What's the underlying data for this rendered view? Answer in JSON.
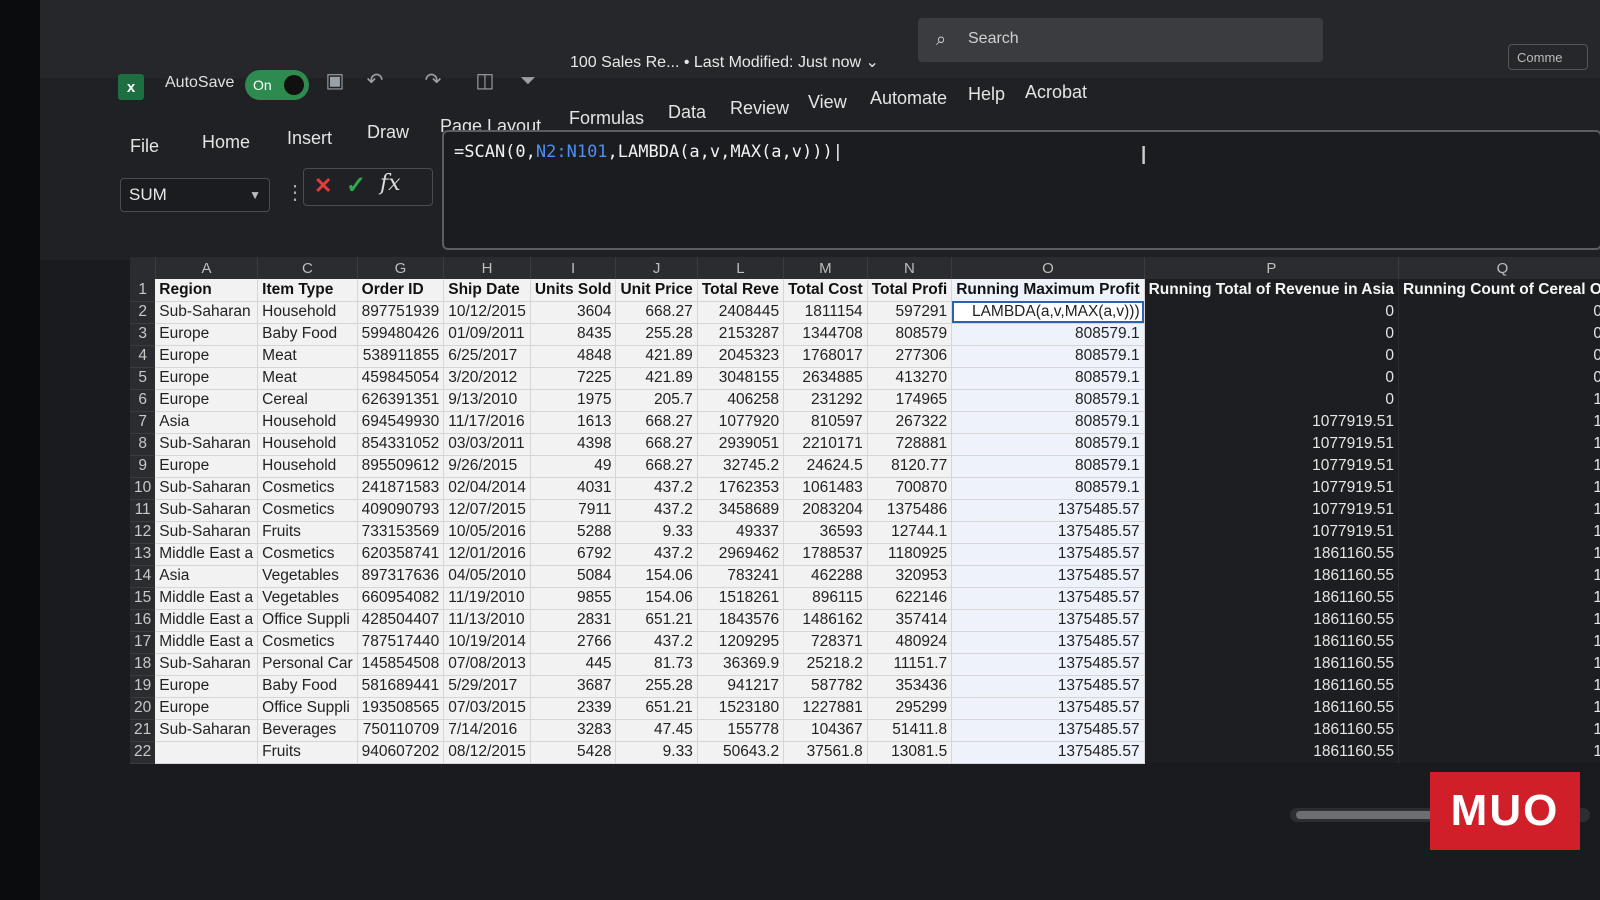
{
  "titlebar": {
    "autosave_label": "AutoSave",
    "autosave_state": "On",
    "doc_title": "100 Sales Re... • Last Modified: Just now ⌄",
    "search_placeholder": "Search",
    "comments_label": "Comme"
  },
  "ribbon": {
    "tabs": [
      "File",
      "Home",
      "Insert",
      "Draw",
      "Page Layout",
      "Formulas",
      "Data",
      "Review",
      "View",
      "Automate",
      "Help",
      "Acrobat"
    ]
  },
  "formula_bar": {
    "name_box": "SUM",
    "formula_prefix": "=SCAN(0,",
    "formula_ref": "N2:N101",
    "formula_suffix": ",LAMBDA(a,v,MAX(a,v)))",
    "fx_label": "fx"
  },
  "grid": {
    "column_letters": [
      "A",
      "C",
      "G",
      "H",
      "I",
      "J",
      "L",
      "M",
      "N",
      "O",
      "P",
      "Q"
    ],
    "headers": [
      "Region",
      "Item Type",
      "Order ID",
      "Ship Date",
      "Units Sold",
      "Unit Price",
      "Total Reve",
      "Total Cost",
      "Total Profi",
      "Running Maximum Profit",
      "Running Total of Revenue in Asia",
      "Running Count of Cereal O"
    ],
    "rows": [
      [
        "Sub-Saharan",
        "Household",
        "897751939",
        "10/12/2015",
        "3604",
        "668.27",
        "2408445",
        "1811154",
        "597291",
        "LAMBDA(a,v,MAX(a,v)))",
        "0",
        "0"
      ],
      [
        "Europe",
        "Baby Food",
        "599480426",
        "01/09/2011",
        "8435",
        "255.28",
        "2153287",
        "1344708",
        "808579",
        "808579.1",
        "0",
        "0"
      ],
      [
        "Europe",
        "Meat",
        "538911855",
        "6/25/2017",
        "4848",
        "421.89",
        "2045323",
        "1768017",
        "277306",
        "808579.1",
        "0",
        "0"
      ],
      [
        "Europe",
        "Meat",
        "459845054",
        "3/20/2012",
        "7225",
        "421.89",
        "3048155",
        "2634885",
        "413270",
        "808579.1",
        "0",
        "0"
      ],
      [
        "Europe",
        "Cereal",
        "626391351",
        "9/13/2010",
        "1975",
        "205.7",
        "406258",
        "231292",
        "174965",
        "808579.1",
        "0",
        "1"
      ],
      [
        "Asia",
        "Household",
        "694549930",
        "11/17/2016",
        "1613",
        "668.27",
        "1077920",
        "810597",
        "267322",
        "808579.1",
        "1077919.51",
        "1"
      ],
      [
        "Sub-Saharan",
        "Household",
        "854331052",
        "03/03/2011",
        "4398",
        "668.27",
        "2939051",
        "2210171",
        "728881",
        "808579.1",
        "1077919.51",
        "1"
      ],
      [
        "Europe",
        "Household",
        "895509612",
        "9/26/2015",
        "49",
        "668.27",
        "32745.2",
        "24624.5",
        "8120.77",
        "808579.1",
        "1077919.51",
        "1"
      ],
      [
        "Sub-Saharan",
        "Cosmetics",
        "241871583",
        "02/04/2014",
        "4031",
        "437.2",
        "1762353",
        "1061483",
        "700870",
        "808579.1",
        "1077919.51",
        "1"
      ],
      [
        "Sub-Saharan",
        "Cosmetics",
        "409090793",
        "12/07/2015",
        "7911",
        "437.2",
        "3458689",
        "2083204",
        "1375486",
        "1375485.57",
        "1077919.51",
        "1"
      ],
      [
        "Sub-Saharan",
        "Fruits",
        "733153569",
        "10/05/2016",
        "5288",
        "9.33",
        "49337",
        "36593",
        "12744.1",
        "1375485.57",
        "1077919.51",
        "1"
      ],
      [
        "Middle East a",
        "Cosmetics",
        "620358741",
        "12/01/2016",
        "6792",
        "437.2",
        "2969462",
        "1788537",
        "1180925",
        "1375485.57",
        "1861160.55",
        "1"
      ],
      [
        "Asia",
        "Vegetables",
        "897317636",
        "04/05/2010",
        "5084",
        "154.06",
        "783241",
        "462288",
        "320953",
        "1375485.57",
        "1861160.55",
        "1"
      ],
      [
        "Middle East a",
        "Vegetables",
        "660954082",
        "11/19/2010",
        "9855",
        "154.06",
        "1518261",
        "896115",
        "622146",
        "1375485.57",
        "1861160.55",
        "1"
      ],
      [
        "Middle East a",
        "Office Suppli",
        "428504407",
        "11/13/2010",
        "2831",
        "651.21",
        "1843576",
        "1486162",
        "357414",
        "1375485.57",
        "1861160.55",
        "1"
      ],
      [
        "Middle East a",
        "Cosmetics",
        "787517440",
        "10/19/2014",
        "2766",
        "437.2",
        "1209295",
        "728371",
        "480924",
        "1375485.57",
        "1861160.55",
        "1"
      ],
      [
        "Sub-Saharan",
        "Personal Car",
        "145854508",
        "07/08/2013",
        "445",
        "81.73",
        "36369.9",
        "25218.2",
        "11151.7",
        "1375485.57",
        "1861160.55",
        "1"
      ],
      [
        "Europe",
        "Baby Food",
        "581689441",
        "5/29/2017",
        "3687",
        "255.28",
        "941217",
        "587782",
        "353436",
        "1375485.57",
        "1861160.55",
        "1"
      ],
      [
        "Europe",
        "Office Suppli",
        "193508565",
        "07/03/2015",
        "2339",
        "651.21",
        "1523180",
        "1227881",
        "295299",
        "1375485.57",
        "1861160.55",
        "1"
      ],
      [
        "Sub-Saharan",
        "Beverages",
        "750110709",
        "7/14/2016",
        "3283",
        "47.45",
        "155778",
        "104367",
        "51411.8",
        "1375485.57",
        "1861160.55",
        "1"
      ],
      [
        "",
        "Fruits",
        "940607202",
        "08/12/2015",
        "5428",
        "9.33",
        "50643.2",
        "37561.8",
        "13081.5",
        "1375485.57",
        "1861160.55",
        "1"
      ]
    ]
  },
  "watermark": "MUO"
}
